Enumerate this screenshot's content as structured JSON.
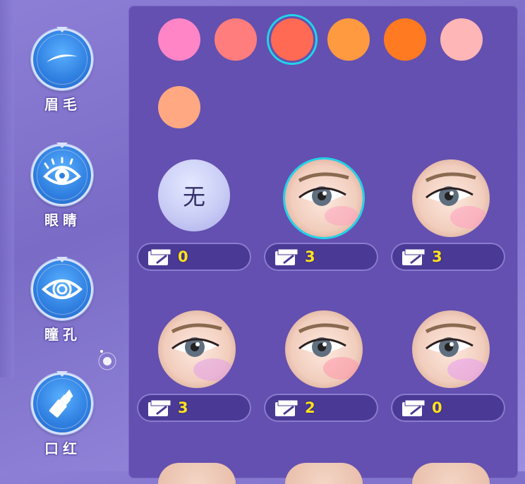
{
  "categories": [
    {
      "label": "眉毛",
      "icon": "eyebrow-icon"
    },
    {
      "label": "眼睛",
      "icon": "eye-icon"
    },
    {
      "label": "瞳孔",
      "icon": "pupil-icon"
    },
    {
      "label": "口红",
      "icon": "lipstick-icon"
    }
  ],
  "colors": {
    "swatches": [
      "#ff85c6",
      "#ff7d7d",
      "#ff6a55",
      "#ff9a40",
      "#ff7a20",
      "#ffb6b6",
      "#ffa882"
    ],
    "selected_index": 2,
    "selection_ring": "#22d4e8"
  },
  "options": [
    {
      "label": "无",
      "price": "0"
    },
    {
      "label": "",
      "price": "3",
      "selected": true
    },
    {
      "label": "",
      "price": "3"
    },
    {
      "label": "",
      "price": "3"
    },
    {
      "label": "",
      "price": "2"
    },
    {
      "label": "",
      "price": "0"
    }
  ]
}
